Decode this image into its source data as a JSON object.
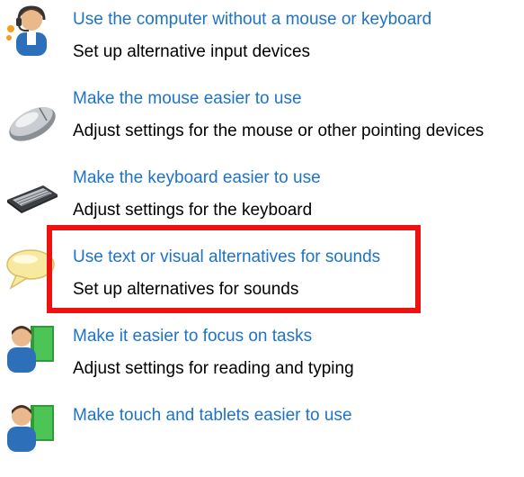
{
  "items": [
    {
      "link": "Use the computer without a mouse or keyboard",
      "desc": "Set up alternative input devices",
      "icon": "person-headset-icon"
    },
    {
      "link": "Make the mouse easier to use",
      "desc": "Adjust settings for the mouse or other pointing devices",
      "icon": "mouse-icon"
    },
    {
      "link": "Make the keyboard easier to use",
      "desc": "Adjust settings for the keyboard",
      "icon": "keyboard-icon"
    },
    {
      "link": "Use text or visual alternatives for sounds",
      "desc": "Set up alternatives for sounds",
      "icon": "speech-bubble-icon"
    },
    {
      "link": "Make it easier to focus on tasks",
      "desc": "Adjust settings for reading and typing",
      "icon": "person-book-icon"
    },
    {
      "link": "Make touch and tablets easier to use",
      "desc": "",
      "icon": "person-book-icon"
    }
  ],
  "colors": {
    "link": "#1e73c8",
    "text": "#000000",
    "highlight": "#ee1111"
  }
}
